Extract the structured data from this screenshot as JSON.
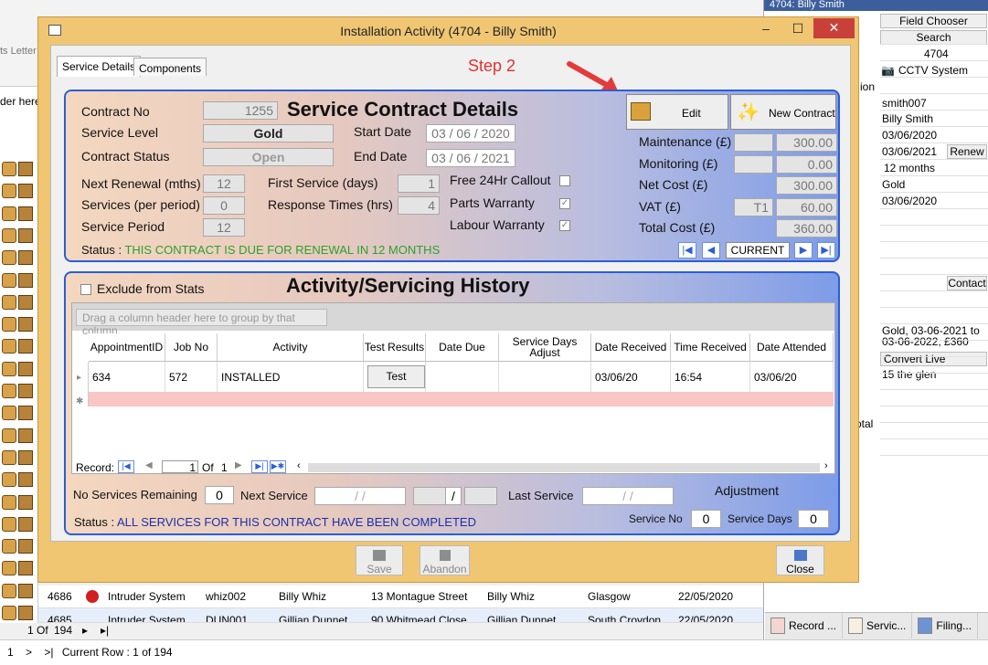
{
  "background": {
    "left_label": "der here",
    "left_toolbar_label": "ts Letter",
    "grid_rows": [
      {
        "id": "4686",
        "type": "Intruder System",
        "ref": "whiz002",
        "name": "Billy Whiz",
        "address": "13 Montague Street",
        "contact": "Billy Whiz",
        "town": "Glasgow",
        "date": "22/05/2020"
      },
      {
        "id": "4685",
        "type": "Intruder System",
        "ref": "DUN001",
        "name": "Gillian Dunnet",
        "address": "90 Whitmead Close",
        "contact": "Gillian Dunnet",
        "town": "South Croydon",
        "date": "22/05/2020"
      }
    ],
    "pager": {
      "page": "1",
      "of_label": "Of",
      "total": "194"
    },
    "status_nav": "1    >    >|",
    "current_row": "Current Row : 1 of 194"
  },
  "right_panel": {
    "title": "4704: Billy Smith",
    "field_chooser": "Field Chooser",
    "search": "Search",
    "id": "4704",
    "system": "CCTV System",
    "left_frag_1": "ion",
    "username": "smith007",
    "name": "Billy Smith",
    "start": "03/06/2020",
    "renew_date": "03/06/2021",
    "renew_label": "Renew",
    "period": "12 months",
    "level": "Gold",
    "date2": "03/06/2020",
    "contact_label": "Contact",
    "summary": "Gold, 03-06-2021 to 03-06-2022, £360",
    "convert": "Convert Live",
    "address": "15 the glen",
    "left_frag_2": "otal",
    "tabs": [
      "Record ...",
      "Servic...",
      "Filing..."
    ]
  },
  "dialog": {
    "title": "Installation Activity (4704 - Billy Smith)",
    "tabs": [
      "Service Details",
      "Components"
    ],
    "annotation": "Step 2",
    "contract": {
      "heading": "Service Contract Details",
      "contract_no_label": "Contract No",
      "contract_no": "1255",
      "service_level_label": "Service Level",
      "service_level": "Gold",
      "contract_status_label": "Contract Status",
      "contract_status": "Open",
      "start_date_label": "Start Date",
      "start_date": "03 / 06 / 2020",
      "end_date_label": "End Date",
      "end_date": "03 / 06 / 2021",
      "next_renewal_label": "Next Renewal (mths)",
      "next_renewal": "12",
      "services_label": "Services (per period)",
      "services": "0",
      "service_period_label": "Service Period",
      "service_period": "12",
      "first_service_label": "First Service (days)",
      "first_service": "1",
      "response_label": "Response Times (hrs)",
      "response": "4",
      "free_callout_label": "Free 24Hr Callout",
      "parts_warranty_label": "Parts Warranty",
      "labour_warranty_label": "Labour Warranty",
      "edit_label": "Edit",
      "new_contract_label": "New Contract",
      "maintenance_label": "Maintenance (£)",
      "maintenance": "300.00",
      "monitoring_label": "Monitoring (£)",
      "monitoring": "0.00",
      "net_cost_label": "Net Cost (£)",
      "net_cost": "300.00",
      "vat_label": "VAT (£)",
      "vat_code": "T1",
      "vat": "60.00",
      "total_label": "Total Cost (£)",
      "total": "360.00",
      "status_prefix": "Status :",
      "status_text": "THIS CONTRACT IS DUE FOR RENEWAL IN 12 MONTHS",
      "current_label": "CURRENT"
    },
    "history": {
      "heading": "Activity/Servicing History",
      "exclude_label": "Exclude from Stats",
      "group_hint": "Drag a column header here to group by that column.",
      "columns": [
        "AppointmentID",
        "Job No",
        "Activity",
        "Test Results",
        "Date Due",
        "Service Days Adjust",
        "Date Received",
        "Time Received",
        "Date Attended"
      ],
      "row": {
        "appointment": "634",
        "job": "572",
        "activity": "INSTALLED",
        "test_btn": "Test Results",
        "date_received": "03/06/20",
        "time_received": "16:54",
        "date_attended": "03/06/20"
      },
      "record_label": "Record:",
      "record_num": "1",
      "record_of": "Of",
      "record_total": "1",
      "no_services_label": "No Services Remaining",
      "no_services": "0",
      "next_service_label": "Next Service",
      "date_placeholder": "/     /",
      "last_service_label": "Last Service",
      "adjustment_label": "Adjustment",
      "service_no_label": "Service No",
      "service_no": "0",
      "service_days_label": "Service Days",
      "service_days": "0",
      "status_prefix": "Status :",
      "status_text": "ALL SERVICES FOR THIS CONTRACT HAVE BEEN COMPLETED"
    },
    "buttons": {
      "save": "Save",
      "abandon": "Abandon",
      "close": "Close"
    }
  }
}
